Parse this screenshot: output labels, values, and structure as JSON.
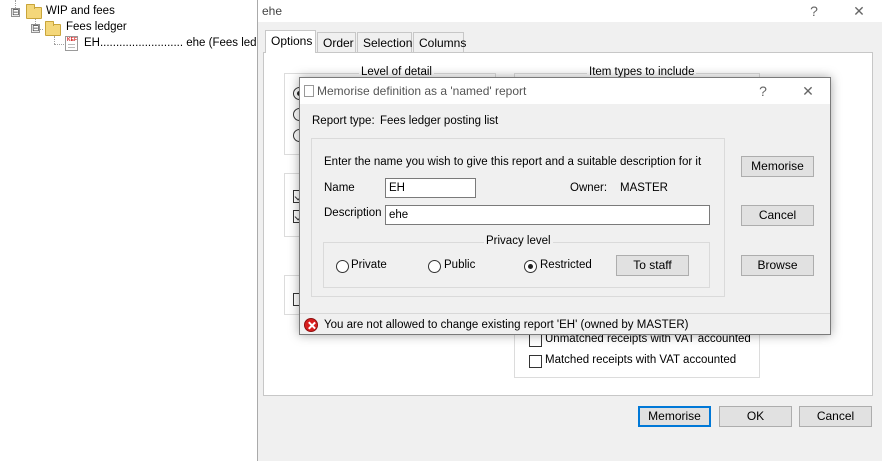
{
  "tree": {
    "items": [
      {
        "label": "WIP and fees",
        "expander": "⊟"
      },
      {
        "label": "Fees ledger",
        "expander": "⊟"
      },
      {
        "label": "EH.......................... ehe (Fees ledger"
      }
    ],
    "doc_badge": "KEF"
  },
  "main_window": {
    "title": "ehe",
    "help_glyph": "?",
    "close_glyph": "✕",
    "tabs": [
      "Options",
      "Order",
      "Selection",
      "Columns"
    ],
    "group_level_of_detail": "Level of detail",
    "group_item_types": "Item types to include",
    "item_types": [
      {
        "label": "Unmatched receipts with VAT accounted",
        "checked": false
      },
      {
        "label": "Matched receipts with VAT accounted",
        "checked": false
      }
    ],
    "buttons": {
      "memorise": "Memorise",
      "ok": "OK",
      "cancel": "Cancel"
    }
  },
  "dialog": {
    "title": "Memorise definition as a 'named' report",
    "help_glyph": "?",
    "close_glyph": "✕",
    "report_type_label": "Report type:",
    "report_type_value": "Fees ledger posting list",
    "instruction": "Enter the name you wish to give this report and a suitable description for it",
    "name_label": "Name",
    "name_value": "EH",
    "owner_label": "Owner:",
    "owner_value": "MASTER",
    "description_label": "Description",
    "description_value": "ehe",
    "privacy_label": "Privacy level",
    "privacy_options": [
      {
        "label": "Private",
        "selected": false
      },
      {
        "label": "Public",
        "selected": false
      },
      {
        "label": "Restricted",
        "selected": true
      }
    ],
    "to_staff_button": "To staff",
    "buttons": {
      "memorise": "Memorise",
      "cancel": "Cancel",
      "browse": "Browse"
    },
    "error_message": "You are not allowed to change existing report 'EH' (owned by MASTER)"
  }
}
